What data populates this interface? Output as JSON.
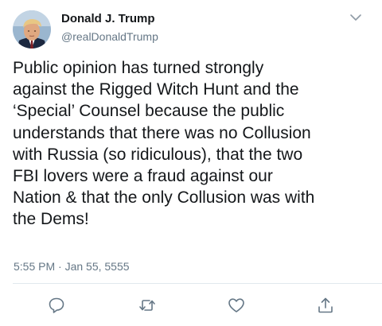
{
  "tweet": {
    "author_name": "Donald J. Trump",
    "author_handle": "@realDonaldTrump",
    "text": "Public opinion has turned strongly\nagainst the Rigged Witch Hunt and the\n‘Special’ Counsel because the public\nunderstands that there was no Collusion\nwith Russia (so ridiculous), that the two\nFBI lovers were a fraud against our\nNation & that the only Collusion was with\nthe Dems!",
    "timestamp": "5:55 PM · Jan 55, 5555"
  },
  "icons": {
    "more": "chevron-down-icon",
    "reply": "reply-icon",
    "retweet": "retweet-icon",
    "like": "heart-icon",
    "share": "share-icon"
  },
  "colors": {
    "text": "#14171a",
    "secondary": "#657786",
    "divider": "#e1e8ed",
    "icon": "#657786"
  }
}
